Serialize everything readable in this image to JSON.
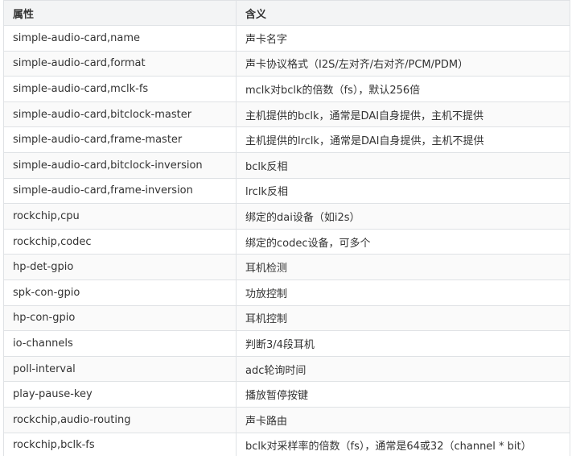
{
  "table": {
    "headers": [
      "属性",
      "含义"
    ],
    "rows": [
      [
        "simple-audio-card,name",
        "声卡名字"
      ],
      [
        "simple-audio-card,format",
        "声卡协议格式（I2S/左对齐/右对齐/PCM/PDM）"
      ],
      [
        "simple-audio-card,mclk-fs",
        "mclk对bclk的倍数（fs），默认256倍"
      ],
      [
        "simple-audio-card,bitclock-master",
        "主机提供的bclk，通常是DAI自身提供，主机不提供"
      ],
      [
        "simple-audio-card,frame-master",
        "主机提供的lrclk，通常是DAI自身提供，主机不提供"
      ],
      [
        "simple-audio-card,bitclock-inversion",
        "bclk反相"
      ],
      [
        "simple-audio-card,frame-inversion",
        "lrclk反相"
      ],
      [
        "rockchip,cpu",
        "绑定的dai设备（如i2s）"
      ],
      [
        "rockchip,codec",
        "绑定的codec设备，可多个"
      ],
      [
        "hp-det-gpio",
        "耳机检测"
      ],
      [
        "spk-con-gpio",
        "功放控制"
      ],
      [
        "hp-con-gpio",
        "耳机控制"
      ],
      [
        "io-channels",
        "判断3/4段耳机"
      ],
      [
        "poll-interval",
        "adc轮询时间"
      ],
      [
        "play-pause-key",
        "播放暂停按键"
      ],
      [
        "rockchip,audio-routing",
        "声卡路由"
      ],
      [
        "rockchip,bclk-fs",
        "bclk对采样率的倍数（fs），通常是64或32（channel * bit）"
      ]
    ]
  }
}
